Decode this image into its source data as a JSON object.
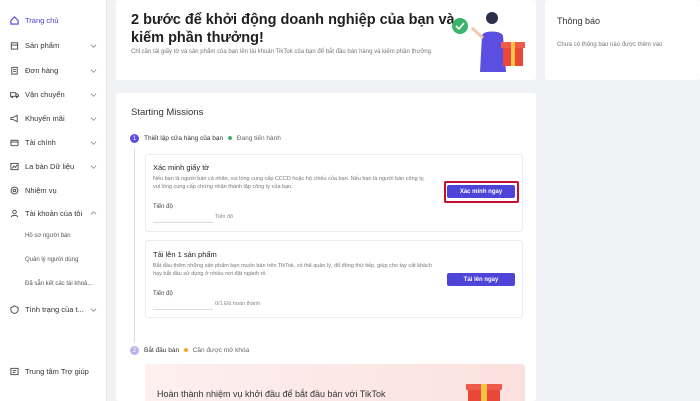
{
  "sidebar": {
    "items": [
      {
        "label": "Trang chủ",
        "icon": "home-icon"
      },
      {
        "label": "Sản phẩm",
        "icon": "box-icon"
      },
      {
        "label": "Đơn hàng",
        "icon": "clipboard-icon"
      },
      {
        "label": "Vận chuyển",
        "icon": "truck-icon"
      },
      {
        "label": "Khuyến mãi",
        "icon": "megaphone-icon"
      },
      {
        "label": "Tài chính",
        "icon": "wallet-icon"
      },
      {
        "label": "La bàn Dữ liệu",
        "icon": "compass-icon"
      },
      {
        "label": "Nhiệm vụ",
        "icon": "target-icon"
      },
      {
        "label": "Tài khoản của tôi",
        "icon": "user-icon"
      },
      {
        "label": "Tình trạng của t...",
        "icon": "status-icon"
      }
    ],
    "subitems": [
      "Hồ sơ người bán",
      "Quản lý người dùng",
      "Đã sẵn kết các tài khoả..."
    ],
    "help": {
      "label": "Trung tâm Trợ giúp",
      "icon": "help-icon"
    }
  },
  "hero": {
    "title": "2 bước để khởi động doanh nghiệp của bạn và kiếm phần thưởng!",
    "subtitle": "Chỉ cần tải giấy tờ và sản phẩm của bạn lên tài khoản TikTok của bạn để bắt đầu bán hàng và kiếm phần thưởng"
  },
  "notification": {
    "title": "Thông báo",
    "text": "Chưa có thông báo nào được thêm vào"
  },
  "missions": {
    "title": "Starting Missions",
    "step1": {
      "number": "1",
      "label": "Thiết lập cửa hàng của bạn",
      "status": "Đang tiến hành",
      "status_color": "#3ab36b"
    },
    "task1": {
      "title": "Xác minh giấy tờ",
      "desc": "Nếu bạn là người bán cá nhân, vui lòng cung cấp CCCD hoặc hộ chiếu của bạn. Nếu bạn là người bán công ty, vui lòng cung cấp chứng nhận thành lập công ty của bạn.",
      "progress_label": "Tiến độ",
      "progress_text": "Tiến độ",
      "button": "Xác minh ngay"
    },
    "task2": {
      "title": "Tải lên 1 sản phẩm",
      "desc": "Bắt đầu thêm những sản phẩm bạn muốn bán trên TikTok, có thể quản lý, đổ đồng thứ tiếp, giúp cho tay cất khách hay bắt đầu sử dụng ở nhiều nơi đặt ngành rẻ.",
      "progress_label": "Tiến độ",
      "progress_text": "0/1 Đã hoàn thành",
      "button": "Tải lên ngay"
    },
    "step2": {
      "number": "2",
      "label": "Bắt đầu bán",
      "status": "Cần được mở khóa",
      "status_color": "#f5a623"
    },
    "promo_text": "Hoàn thành nhiệm vụ khởi đầu để bắt đầu bán với TikTok"
  },
  "colors": {
    "accent": "#4f44d8",
    "highlight": "#c8102e"
  }
}
